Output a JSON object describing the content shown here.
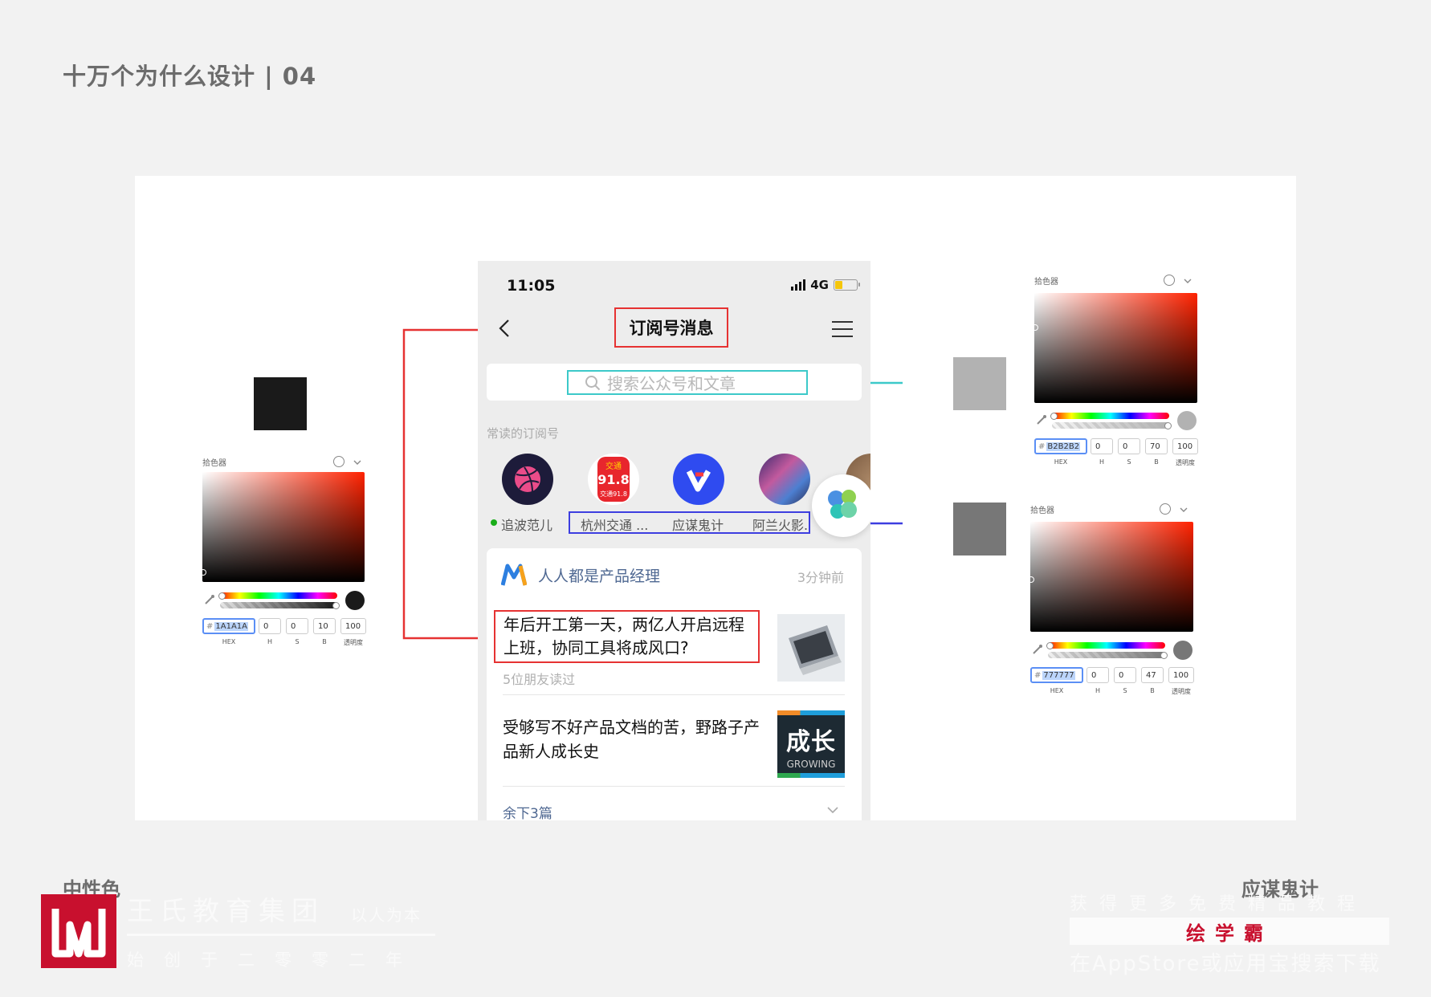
{
  "slide": {
    "title": "十万个为什么设计 | 04",
    "left_caption": "中性色",
    "right_caption": "应谋鬼计"
  },
  "swatches": {
    "left": "#1A1A1A",
    "right_top": "#B2B2B2",
    "right_bottom": "#777777"
  },
  "phone": {
    "status": {
      "time": "11:05",
      "network": "4G",
      "battery_level": 0.3
    },
    "nav": {
      "title": "订阅号消息",
      "back_icon": "chevron-left-icon",
      "menu_icon": "hamburger-menu-icon"
    },
    "search": {
      "placeholder": "搜索公众号和文章"
    },
    "frequent": {
      "section_label": "常读的订阅号",
      "accounts": [
        {
          "name": "追波范儿",
          "unread": true
        },
        {
          "name": "杭州交通 ..."
        },
        {
          "name": "应谋鬼计"
        },
        {
          "name": "阿兰火影."
        }
      ],
      "avatar_text": {
        "badge_top": "交通",
        "badge_num": "91.8",
        "badge_bottom": "交通91.8"
      }
    },
    "feed": {
      "publisher": "人人都是产品经理",
      "time": "3分钟前",
      "articles": [
        {
          "title": "年后开工第一天，两亿人开启远程上班，协同工具将成风口?",
          "meta": "5位朋友读过"
        },
        {
          "title": "受够写不好产品文档的苦，野路子产品新人成长史",
          "thumb_big": "成长",
          "thumb_small": "GROWING"
        }
      ],
      "more": "余下3篇"
    }
  },
  "pickers": {
    "title": "拾色器",
    "labels": {
      "hex": "HEX",
      "h": "H",
      "s": "S",
      "b": "B",
      "alpha": "透明度"
    },
    "left": {
      "hex": "1A1A1A",
      "h": "0",
      "s": "0",
      "b": "10",
      "alpha": "100",
      "preview": "#1a1a1a"
    },
    "right_top": {
      "hex": "B2B2B2",
      "h": "0",
      "s": "0",
      "b": "70",
      "alpha": "100",
      "preview": "#b2b2b2"
    },
    "right_bottom": {
      "hex": "777777",
      "h": "0",
      "s": "0",
      "b": "47",
      "alpha": "100",
      "preview": "#777777"
    }
  },
  "annotation_colors": {
    "red": "#e63232",
    "cyan": "#3cc9c9",
    "blue": "#3d3ee0"
  },
  "footer": {
    "company": "王氏教育集团",
    "tagline": "以人为本",
    "founded": "始创于二零零二年",
    "promo_line1": "获得更多免费精品教程",
    "promo_brand": "绘学霸",
    "promo_line3": "在AppStore或应用宝搜索下载"
  }
}
